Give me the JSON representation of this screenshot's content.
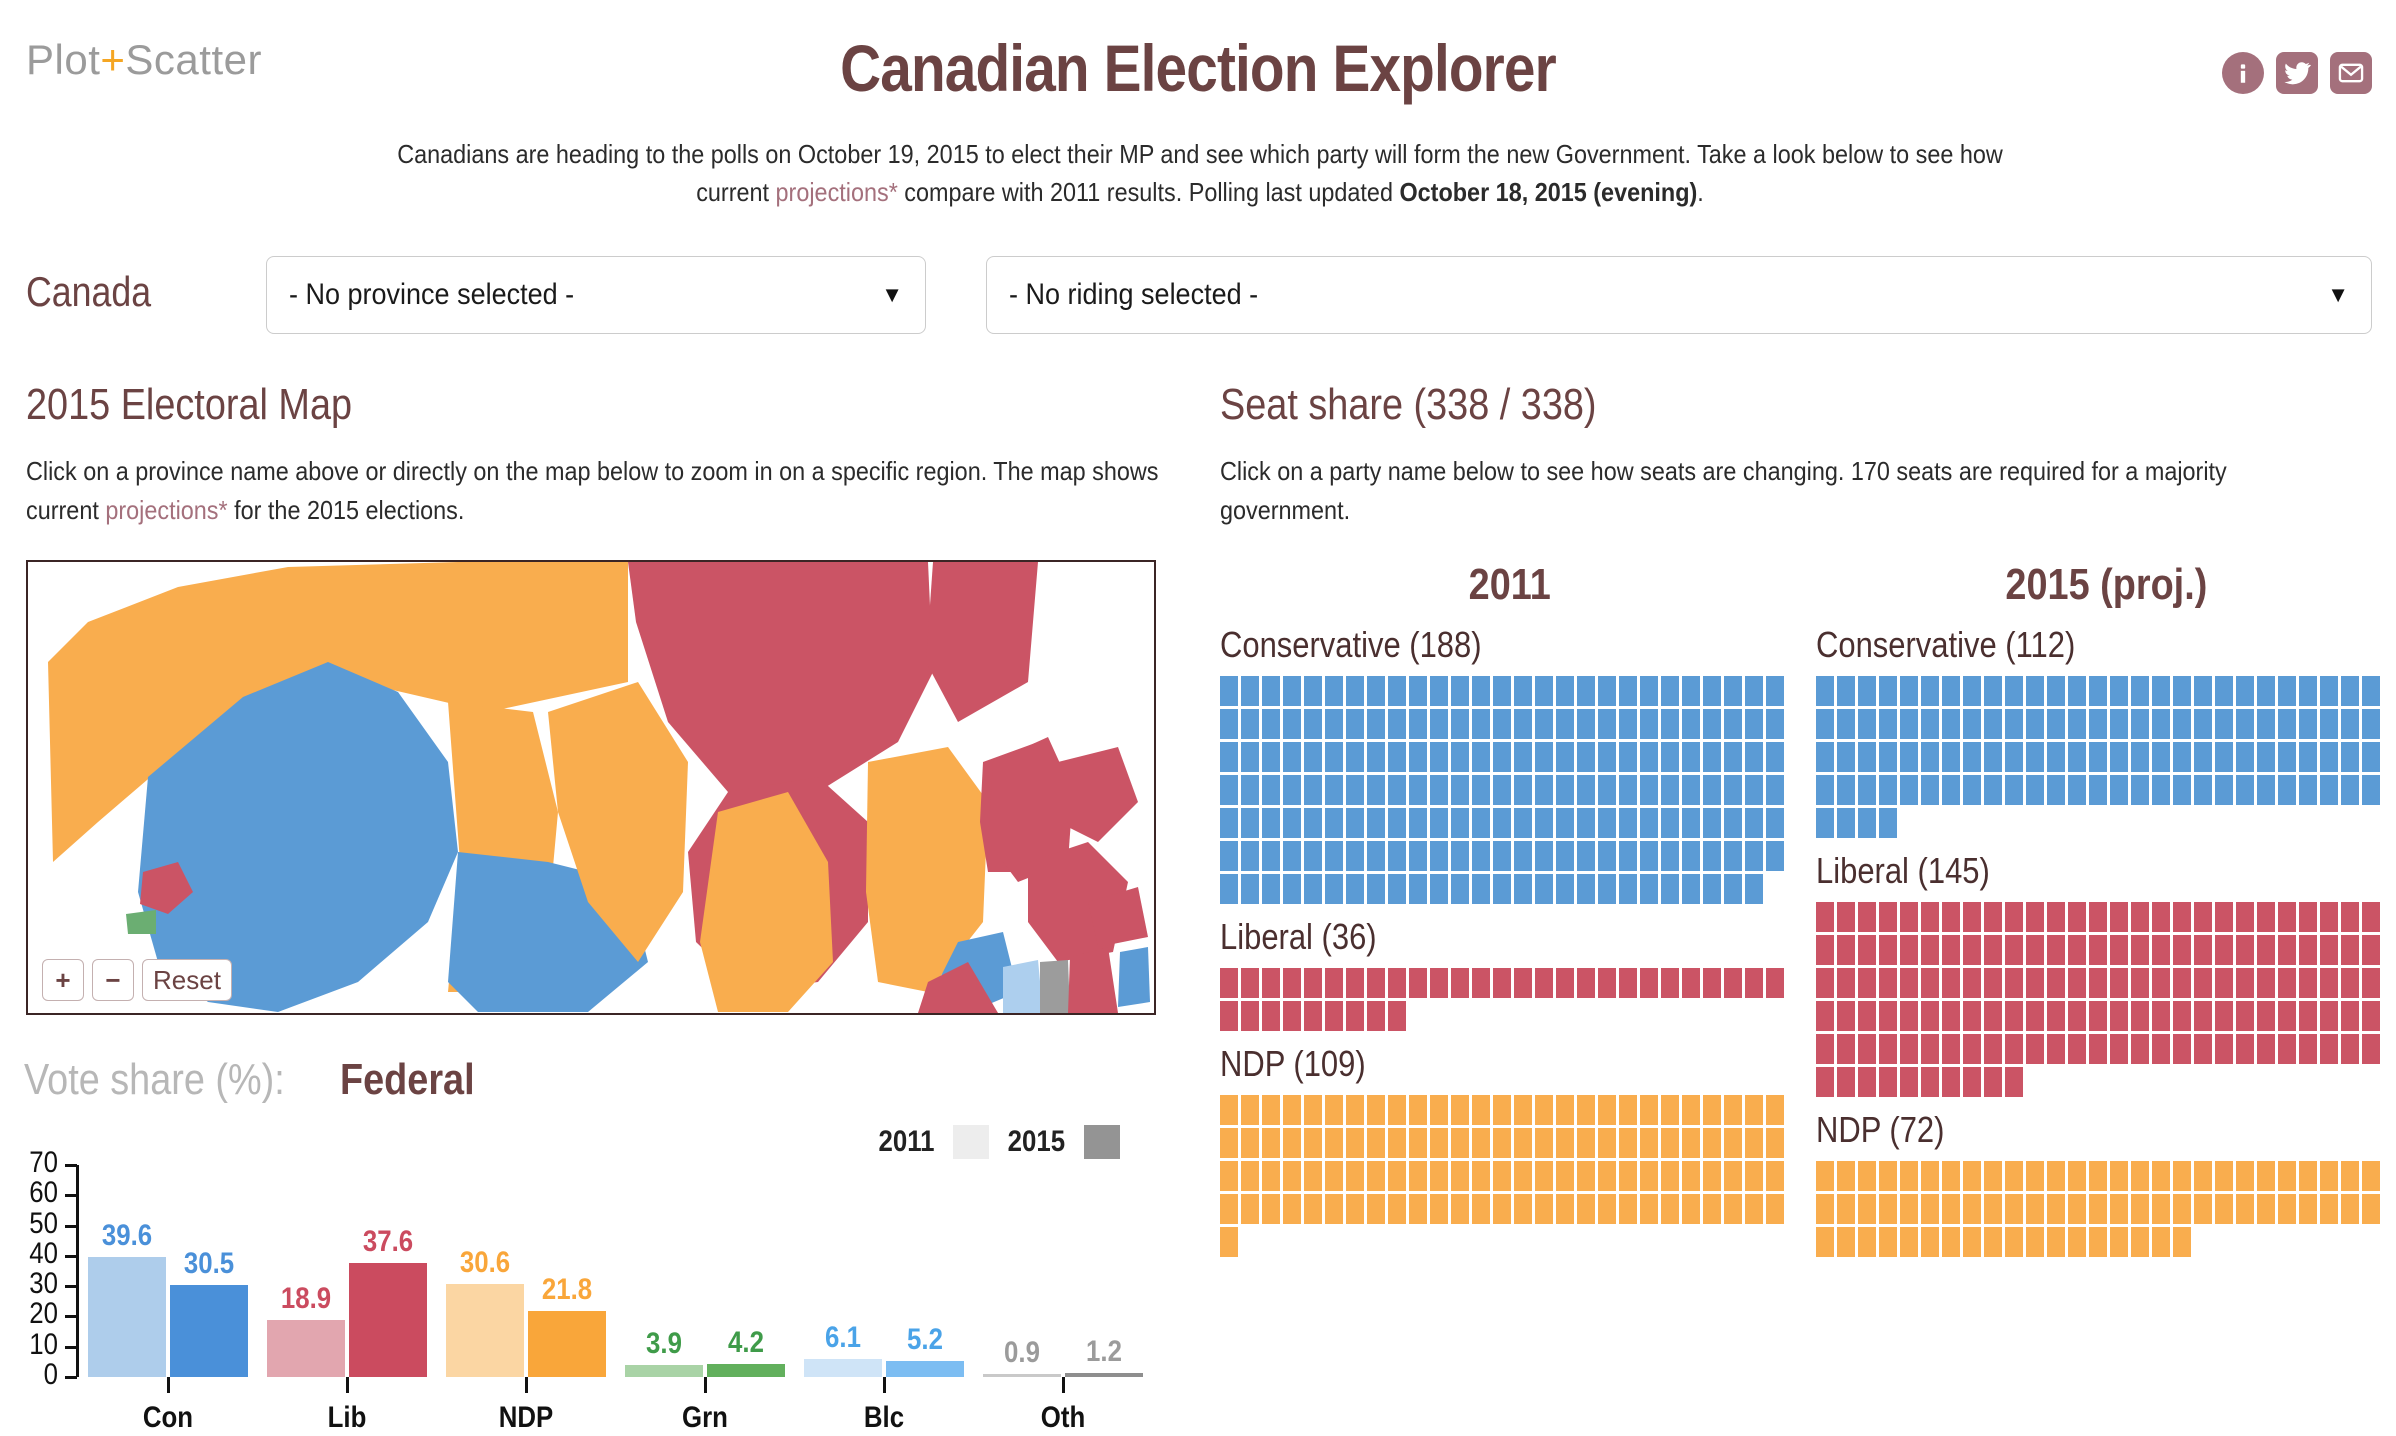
{
  "brand": {
    "part1": "Plot",
    "plus": "+",
    "part2": "Scatter"
  },
  "header": {
    "title": "Canadian Election Explorer",
    "social": [
      {
        "name": "info-icon",
        "label": "Info"
      },
      {
        "name": "twitter-icon",
        "label": "Twitter"
      },
      {
        "name": "email-icon",
        "label": "Email"
      }
    ]
  },
  "intro": {
    "line1_a": "Canadians are heading to the polls on October 19, 2015 to elect their MP and see which party will form the new Government. Take a look below to see how current ",
    "link": "projections*",
    "line1_b": " compare with 2011 results. Polling last updated ",
    "bold": "October 18, 2015 (evening)",
    "tail": "."
  },
  "selector": {
    "region_label": "Canada",
    "province_value": "- No province selected -",
    "riding_value": "- No riding selected -",
    "caret": "▼"
  },
  "map_section": {
    "title": "2015 Electoral Map",
    "desc_a": "Click on a province name above or directly on the map below to zoom in on a specific region. The map shows current ",
    "desc_link": "projections*",
    "desc_b": " for the 2015 elections.",
    "controls": {
      "zoom_in": "+",
      "zoom_out": "−",
      "reset": "Reset"
    }
  },
  "vote_section": {
    "label_grey": "Vote share (%):",
    "label_dark": "Federal"
  },
  "seat_section": {
    "title": "Seat share (338 / 338)",
    "desc": "Click on a party name below to see how seats are changing. 170 seats are required for a majority government.",
    "columns": [
      {
        "year": "2011",
        "parties": [
          {
            "name": "Conservative (188)",
            "seats": 188,
            "color": "#5b9bd5"
          },
          {
            "name": "Liberal (36)",
            "seats": 36,
            "color": "#cb5465"
          },
          {
            "name": "NDP (109)",
            "seats": 109,
            "color": "#f9ad4e"
          }
        ]
      },
      {
        "year": "2015 (proj.)",
        "parties": [
          {
            "name": "Conservative (112)",
            "seats": 112,
            "color": "#5b9bd5"
          },
          {
            "name": "Liberal (145)",
            "seats": 145,
            "color": "#cb5465"
          },
          {
            "name": "NDP (72)",
            "seats": 72,
            "color": "#f9ad4e"
          }
        ]
      }
    ]
  },
  "chart_data": {
    "type": "bar",
    "title": "Vote share (%): Federal",
    "xlabel": "",
    "ylabel": "",
    "ylim": [
      0,
      70
    ],
    "yticks": [
      0,
      10,
      20,
      30,
      40,
      50,
      60,
      70
    ],
    "grid": false,
    "legend": [
      {
        "name": "2011",
        "color": "#ededed"
      },
      {
        "name": "2015",
        "color": "#949494"
      }
    ],
    "legend_position": "top-right",
    "categories": [
      "Con",
      "Lib",
      "NDP",
      "Grn",
      "Blc",
      "Oth"
    ],
    "series": [
      {
        "name": "2011",
        "values": [
          39.6,
          18.9,
          30.6,
          3.9,
          6.1,
          0.9
        ]
      },
      {
        "name": "2015",
        "values": [
          30.5,
          37.6,
          21.8,
          4.2,
          5.2,
          1.2
        ]
      }
    ],
    "colors_2011": [
      "#aecdeb",
      "#e2a6af",
      "#fbd6a3",
      "#a9d3a6",
      "#cfe4f7",
      "#c9c9c9"
    ],
    "colors_2015": [
      "#4a90d9",
      "#cb4b5f",
      "#f9a63a",
      "#62b05d",
      "#7cbdf2",
      "#8e8e8e"
    ],
    "label_colors": [
      "#4a90d9",
      "#cb4b5f",
      "#f9a63a",
      "#3f9b49",
      "#4aa3e8",
      "#9b9b9b"
    ]
  },
  "colors": {
    "accent_maroon": "#6b4343",
    "link": "#a4707c",
    "conservative": "#5b9bd5",
    "liberal": "#cb5465",
    "ndp": "#f9ad4e",
    "green": "#62b05d"
  }
}
